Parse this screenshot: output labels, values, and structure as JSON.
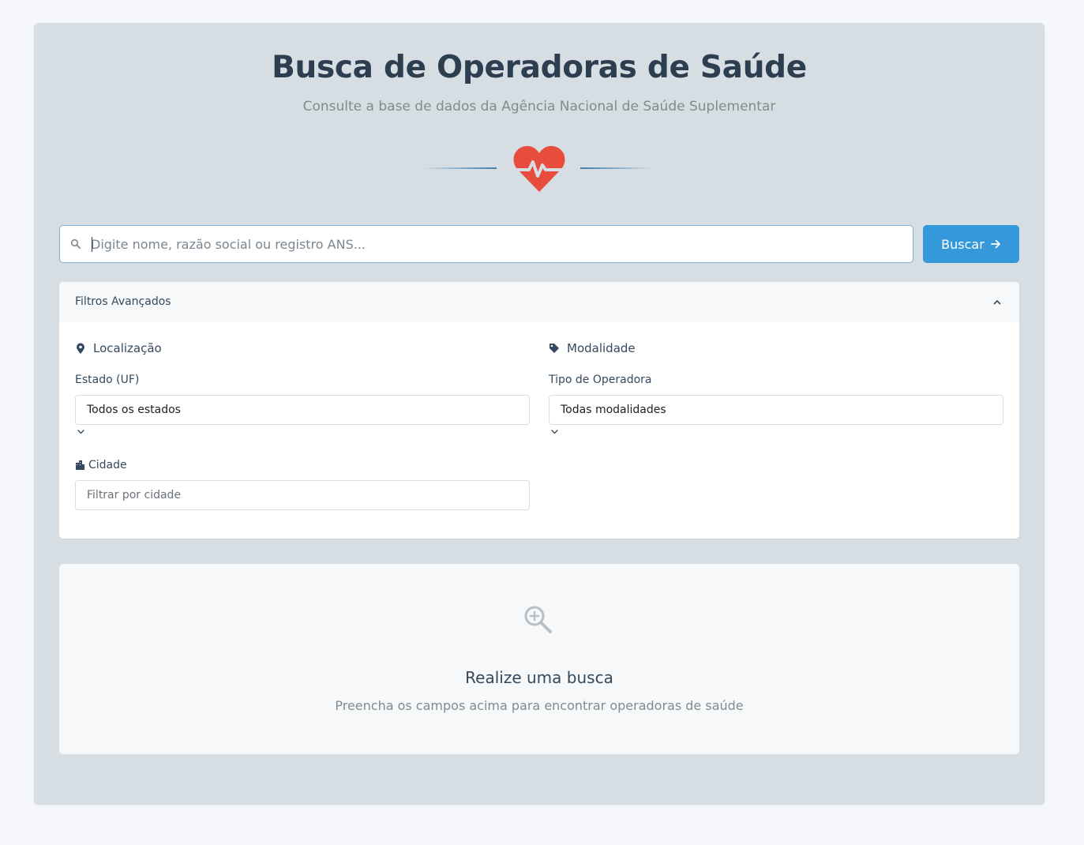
{
  "header": {
    "title": "Busca de Operadoras de Saúde",
    "subtitle": "Consulte a base de dados da Agência Nacional de Saúde Suplementar",
    "icon": "heart-pulse-icon"
  },
  "search": {
    "placeholder": "Digite nome, razão social ou registro ANS...",
    "value": "",
    "button_label": "Buscar",
    "button_icon": "arrow-right-icon"
  },
  "filters": {
    "title": "Filtros Avançados",
    "expanded": true,
    "location": {
      "title": "Localização",
      "icon": "map-pin-icon",
      "state_label": "Estado (UF)",
      "state_value": "Todos os estados",
      "city_label": "Cidade",
      "city_icon": "city-buildings-icon",
      "city_placeholder": "Filtrar por cidade"
    },
    "modality": {
      "title": "Modalidade",
      "icon": "tag-icon",
      "type_label": "Tipo de Operadora",
      "type_value": "Todas modalidades"
    }
  },
  "empty_state": {
    "icon": "zoom-in-icon",
    "title": "Realize uma busca",
    "text": "Preencha os campos acima para encontrar operadoras de saúde"
  },
  "colors": {
    "page_bg": "#f5f7fa",
    "panel_bg": "#d6dde3",
    "accent": "#3498db",
    "heart": "#e74c3c",
    "title": "#2c3e50",
    "muted": "#7f8c8d"
  }
}
